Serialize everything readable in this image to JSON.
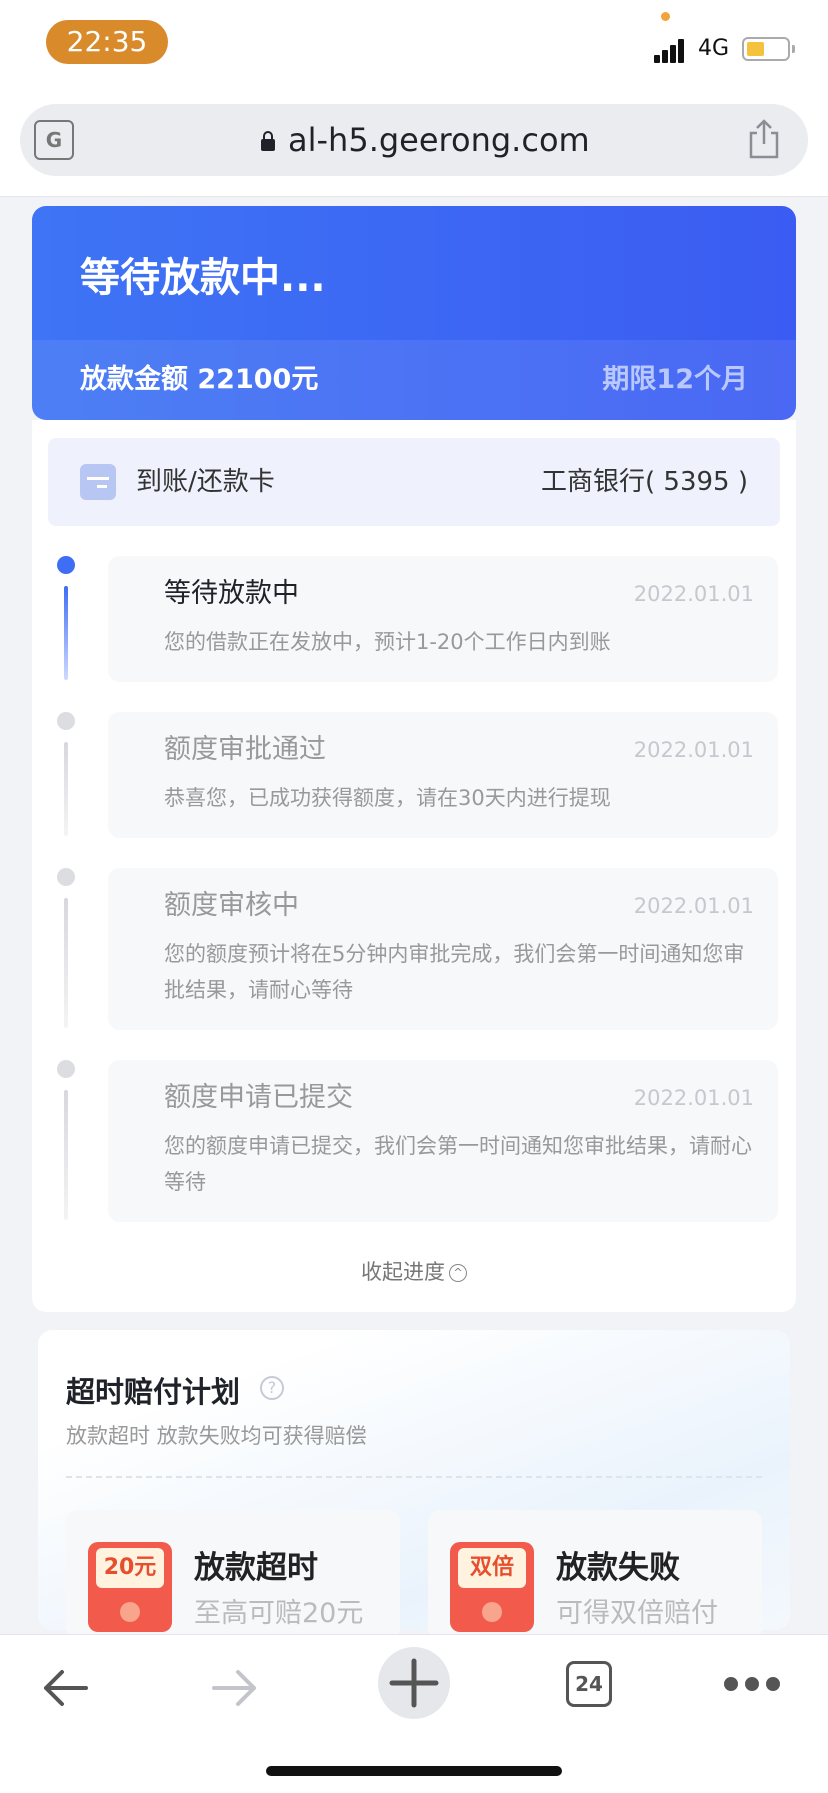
{
  "status_bar": {
    "time": "22:35",
    "network": "4G",
    "battery_level": 0.35
  },
  "browser": {
    "url": "al-h5.geerong.com",
    "tab_count": "24"
  },
  "loan": {
    "status_title": "等待放款中...",
    "amount_text": "放款金额 22100元",
    "term_text": "期限12个月",
    "card_label": "到账/还款卡",
    "card_value": "工商银行( 5395 )"
  },
  "timeline": [
    {
      "title": "等待放款中",
      "date": "2022.01.01",
      "desc": "您的借款正在发放中，预计1-20个工作日内到账",
      "active": true
    },
    {
      "title": "额度审批通过",
      "date": "2022.01.01",
      "desc": "恭喜您，已成功获得额度，请在30天内进行提现",
      "active": false
    },
    {
      "title": "额度审核中",
      "date": "2022.01.01",
      "desc": "您的额度预计将在5分钟内审批完成，我们会第一时间通知您审批结果，请耐心等待",
      "active": false
    },
    {
      "title": "额度申请已提交",
      "date": "2022.01.01",
      "desc": "您的额度申请已提交，我们会第一时间通知您审批结果，请耐心等待",
      "active": false
    }
  ],
  "collapse_label": "收起进度",
  "compensation": {
    "title": "超时赔付计划",
    "subtitle": "放款超时 放款失败均可获得赔偿",
    "items": [
      {
        "badge": "20元",
        "title": "放款超时",
        "subtitle": "至高可赔20元"
      },
      {
        "badge": "双倍",
        "title": "放款失败",
        "subtitle": "可得双倍赔付"
      }
    ]
  },
  "colors": {
    "primary": "#3e74f5",
    "status_time_bg": "#d98a2b",
    "envelope": "#f25a4b"
  }
}
